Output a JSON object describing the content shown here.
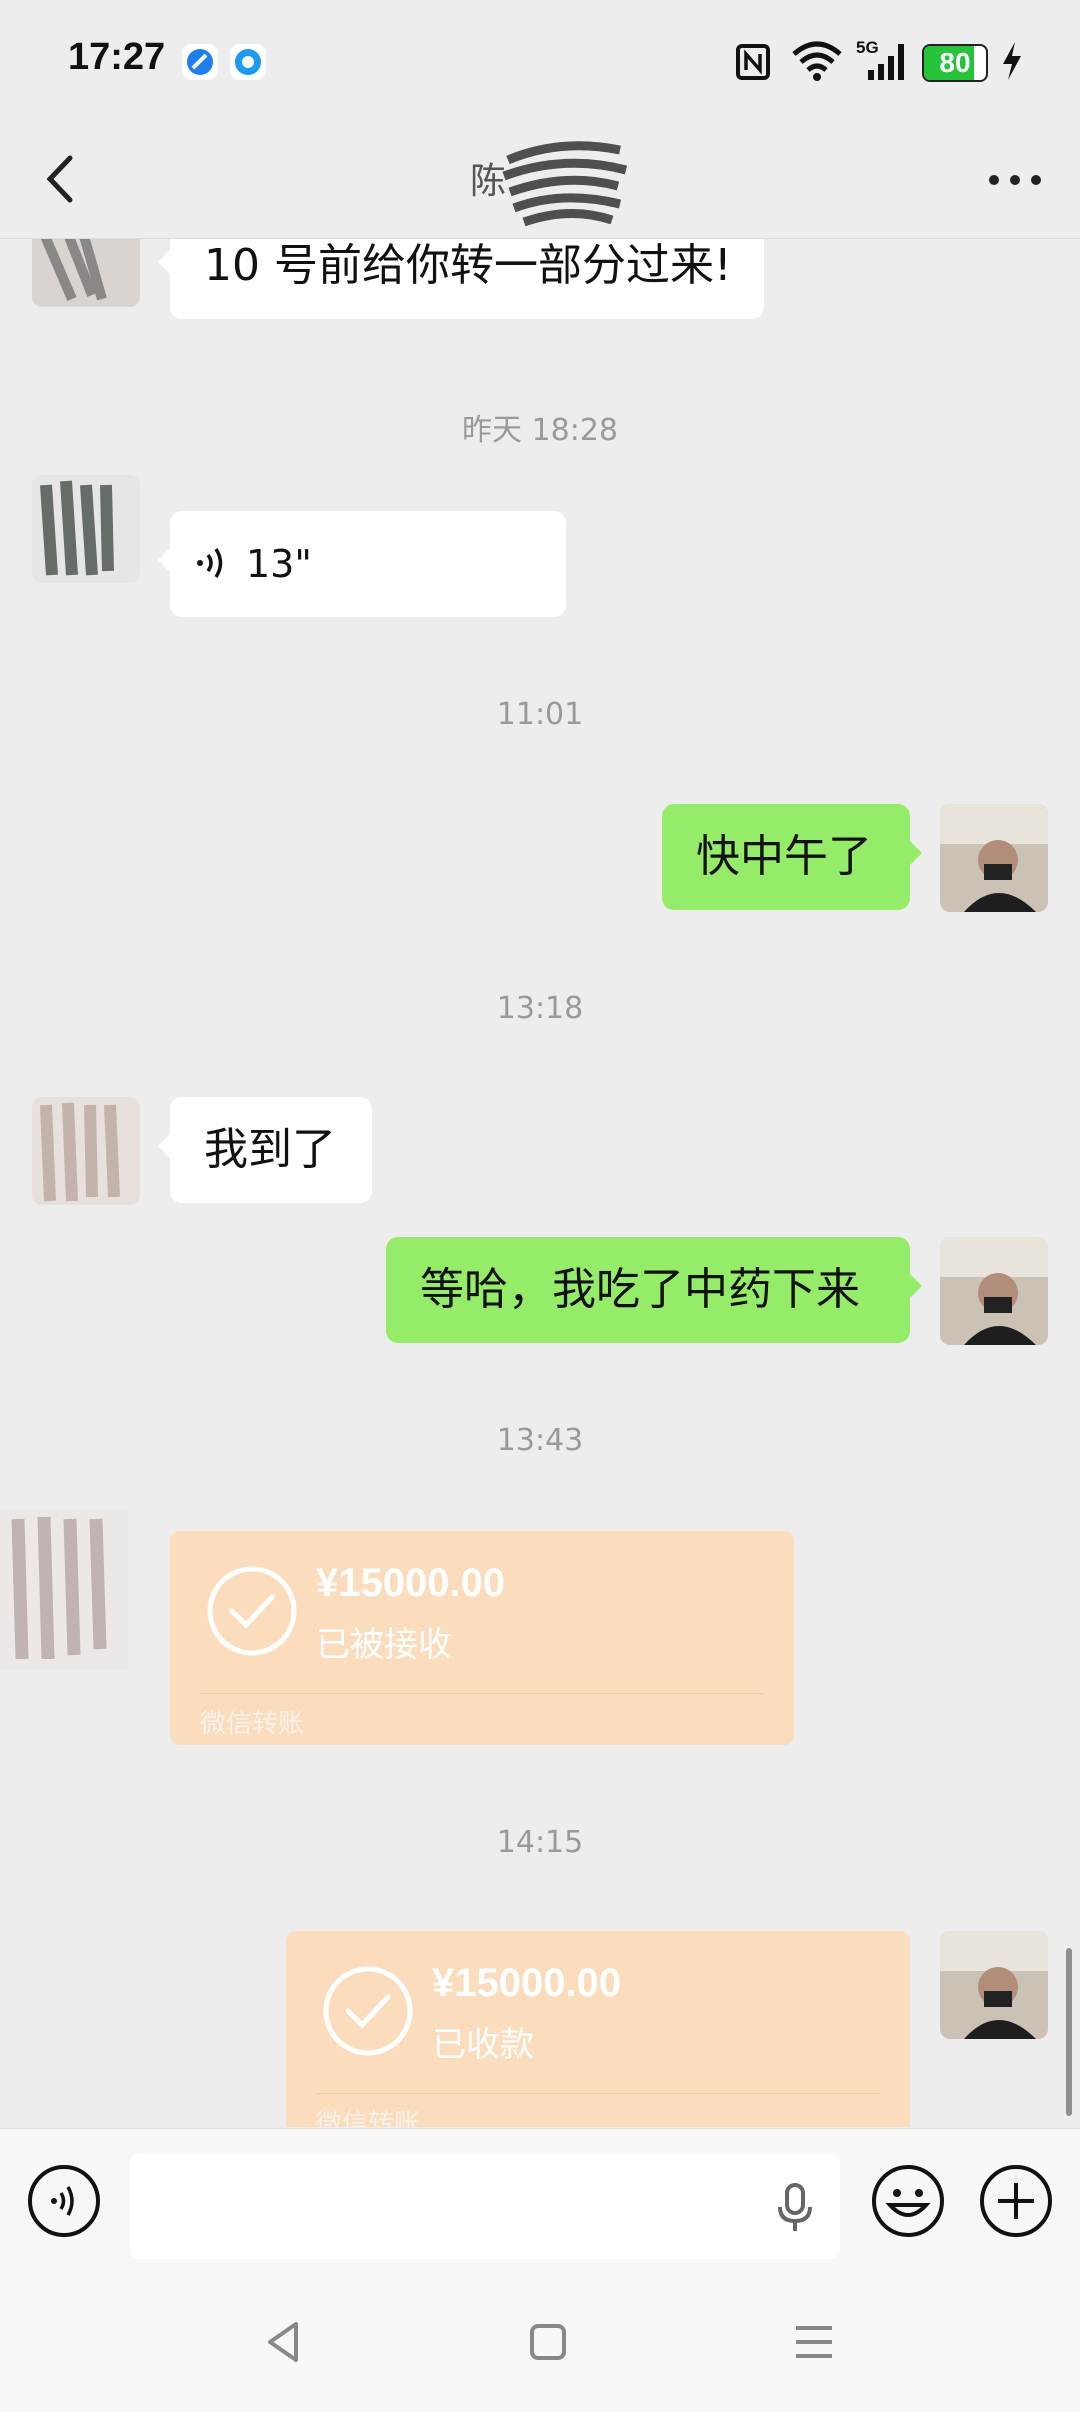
{
  "status_bar": {
    "time": "17:27",
    "network": "5G",
    "battery_level": "80",
    "battery_fraction": 0.8
  },
  "header": {
    "title": "陈"
  },
  "messages": [
    {
      "type": "text",
      "side": "in",
      "text": "10 号前给你转一部分过来!"
    },
    {
      "type": "timestamp",
      "text": "昨天 18:28"
    },
    {
      "type": "voice",
      "side": "in",
      "duration": "13\""
    },
    {
      "type": "timestamp",
      "text": "11:01"
    },
    {
      "type": "text",
      "side": "out",
      "text": "快中午了"
    },
    {
      "type": "timestamp",
      "text": "13:18"
    },
    {
      "type": "text",
      "side": "in",
      "text": "我到了"
    },
    {
      "type": "text",
      "side": "out",
      "text": "等哈，我吃了中药下来"
    },
    {
      "type": "timestamp",
      "text": "13:43"
    },
    {
      "type": "transfer",
      "side": "in",
      "amount": "¥15000.00",
      "status": "已被接收",
      "label": "微信转账"
    },
    {
      "type": "timestamp",
      "text": "14:15"
    },
    {
      "type": "transfer",
      "side": "out",
      "amount": "¥15000.00",
      "status": "已收款",
      "label": "微信转账"
    }
  ],
  "icons": {
    "back": "chevron-left-icon",
    "more": "more-icon",
    "voice_toggle": "voice-icon",
    "mic": "microphone-icon",
    "emoji": "emoji-icon",
    "plus": "plus-icon"
  },
  "colors": {
    "outgoing_bubble": "#95ec69",
    "incoming_bubble": "#ffffff",
    "transfer_card": "#fbdcbd",
    "background": "#ededed"
  }
}
